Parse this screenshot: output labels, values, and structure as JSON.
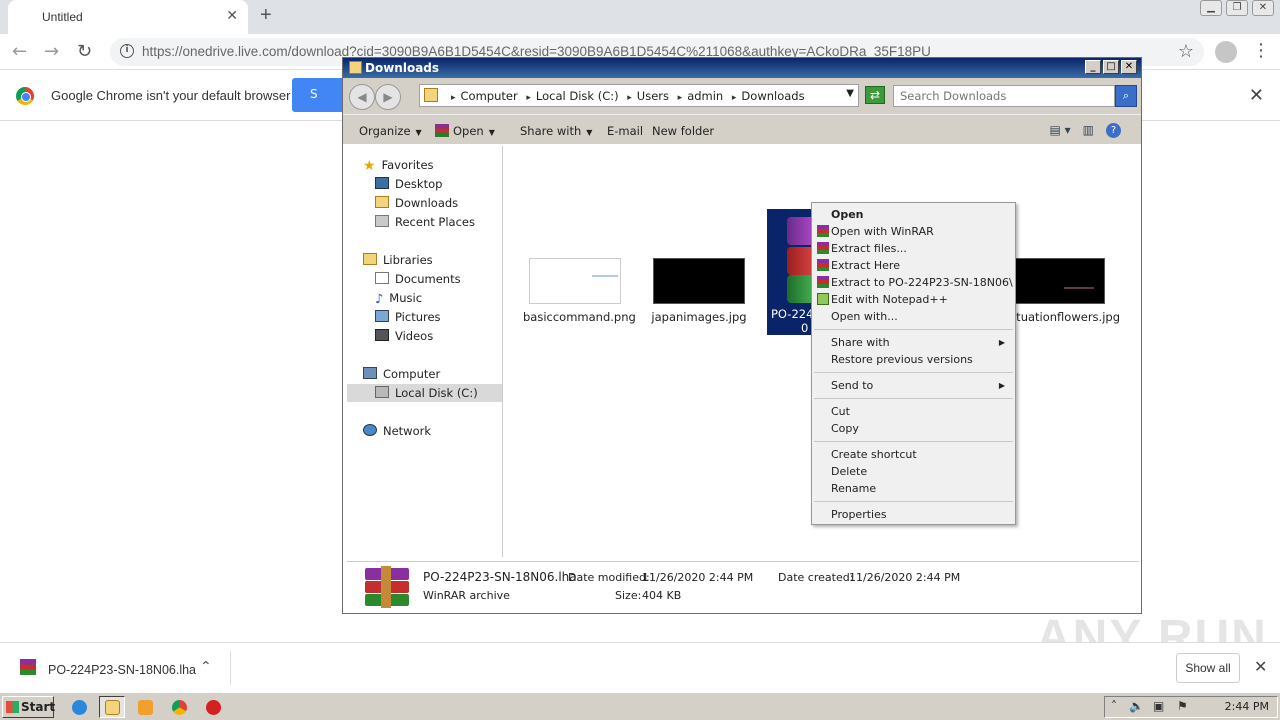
{
  "browser": {
    "tab_title": "Untitled",
    "url": "https://onedrive.live.com/download?cid=3090B9A6B1D5454C&resid=3090B9A6B1D5454C%211068&authkey=ACkoDRa_35F18PU",
    "infobar_message": "Google Chrome isn't your default browser",
    "infobar_button": "S"
  },
  "explorer": {
    "title": "Downloads",
    "breadcrumbs": [
      "Computer",
      "Local Disk (C:)",
      "Users",
      "admin",
      "Downloads"
    ],
    "search_placeholder": "Search Downloads",
    "toolbar": {
      "organize": "Organize",
      "open": "Open",
      "share_with": "Share with",
      "email": "E-mail",
      "new_folder": "New folder"
    },
    "nav": {
      "favorites": "Favorites",
      "desktop": "Desktop",
      "downloads": "Downloads",
      "recent_places": "Recent Places",
      "libraries": "Libraries",
      "documents": "Documents",
      "music": "Music",
      "pictures": "Pictures",
      "videos": "Videos",
      "computer": "Computer",
      "local_disk": "Local Disk (C:)",
      "network": "Network"
    },
    "files": [
      {
        "name": "basiccommand.png"
      },
      {
        "name": "japanimages.jpg"
      },
      {
        "name": "PO-224P23-SN-18N06.lha",
        "label_line1": "PO-224P",
        "label_line2": "0"
      },
      {
        "name": "situationflowers.jpg"
      }
    ],
    "details": {
      "file_name": "PO-224P23-SN-18N06.lha",
      "type": "WinRAR archive",
      "date_modified_label": "Date modified:",
      "date_modified": "11/26/2020 2:44 PM",
      "date_created_label": "Date created:",
      "date_created": "11/26/2020 2:44 PM",
      "size_label": "Size:",
      "size": "404 KB"
    }
  },
  "context_menu": {
    "open": "Open",
    "open_with_winrar": "Open with WinRAR",
    "extract_files": "Extract files...",
    "extract_here": "Extract Here",
    "extract_to": "Extract to PO-224P23-SN-18N06\\",
    "edit_notepad": "Edit with Notepad++",
    "open_with": "Open with...",
    "share_with": "Share with",
    "restore_versions": "Restore previous versions",
    "send_to": "Send to",
    "cut": "Cut",
    "copy": "Copy",
    "create_shortcut": "Create shortcut",
    "delete": "Delete",
    "rename": "Rename",
    "properties": "Properties"
  },
  "download_shelf": {
    "file_name": "PO-224P23-SN-18N06.lha",
    "show_all": "Show all"
  },
  "taskbar": {
    "start": "Start",
    "time": "2:44 PM"
  },
  "watermark": "ANY RUN",
  "colors": {
    "selection": "#0a246a",
    "chrome_blue": "#4285f4",
    "classic_gray": "#d4d0c8"
  }
}
